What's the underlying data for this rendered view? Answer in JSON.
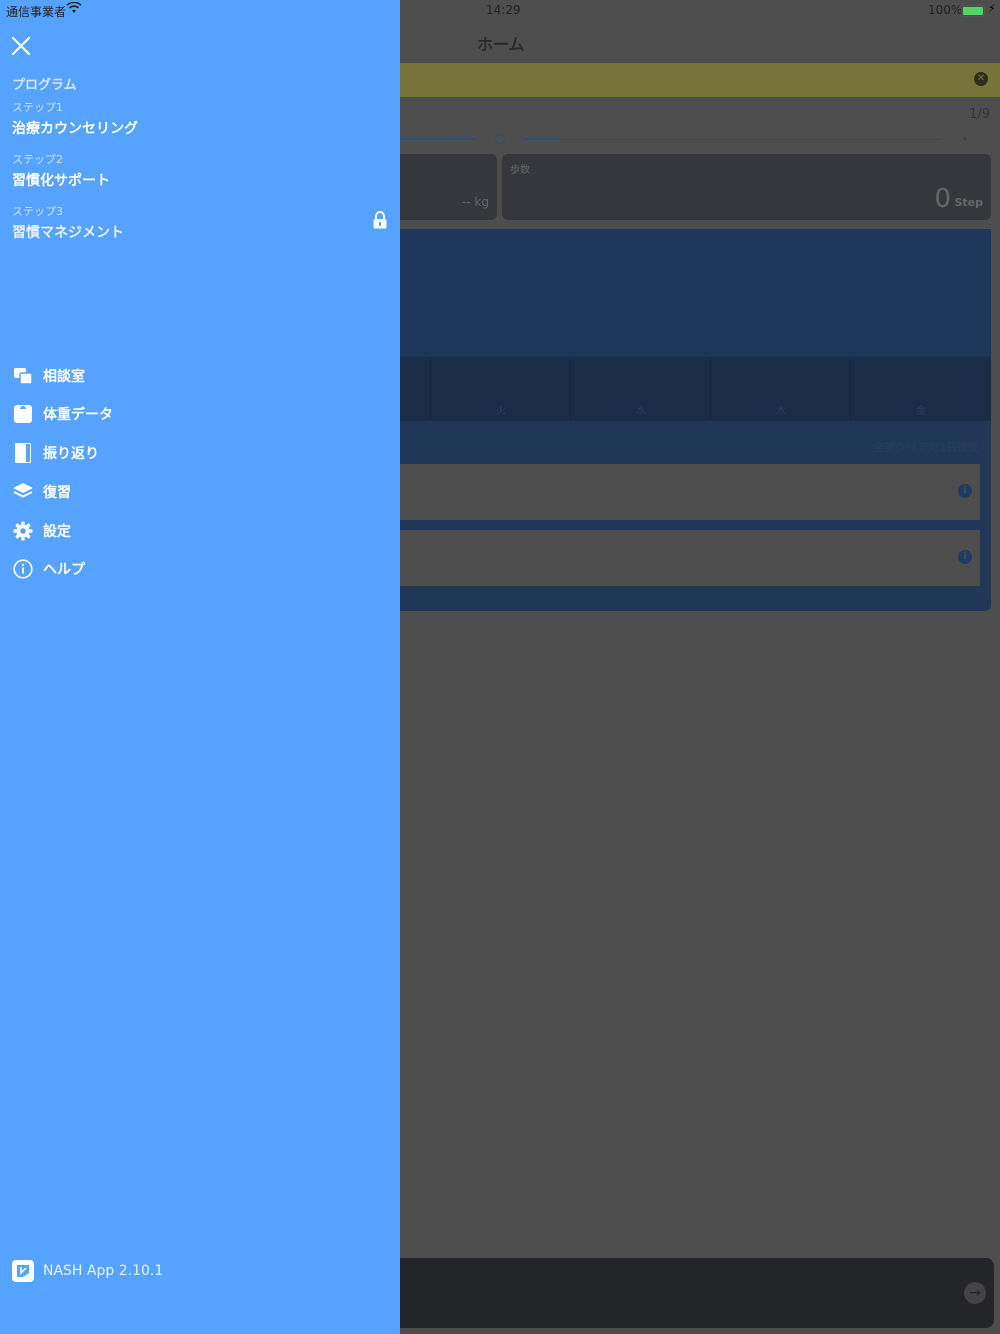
{
  "status": {
    "carrier": "通信事業者",
    "time": "14:29",
    "battery": "100%"
  },
  "main": {
    "title": "ホーム",
    "progress": "1/9",
    "weight_value": "-- kg",
    "steps_label": "歩数",
    "steps_value": "0",
    "steps_unit": "Step",
    "days": [
      "火",
      "水",
      "木",
      "金"
    ],
    "panel_note": "全部クリアで1日達成"
  },
  "drawer": {
    "section": "プログラム",
    "steps": [
      {
        "sub": "ステップ1",
        "title": "治療カウンセリング",
        "locked": false
      },
      {
        "sub": "ステップ2",
        "title": "習慣化サポート",
        "locked": false
      },
      {
        "sub": "ステップ3",
        "title": "習慣マネジメント",
        "locked": true
      }
    ],
    "menu": [
      {
        "label": "相談室",
        "icon": "chat-icon"
      },
      {
        "label": "体重データ",
        "icon": "scale-icon"
      },
      {
        "label": "振り返り",
        "icon": "book-icon"
      },
      {
        "label": "復習",
        "icon": "layers-icon"
      },
      {
        "label": "設定",
        "icon": "gear-icon"
      },
      {
        "label": "ヘルプ",
        "icon": "info-icon"
      }
    ],
    "version": "NASH App 2.10.1"
  }
}
